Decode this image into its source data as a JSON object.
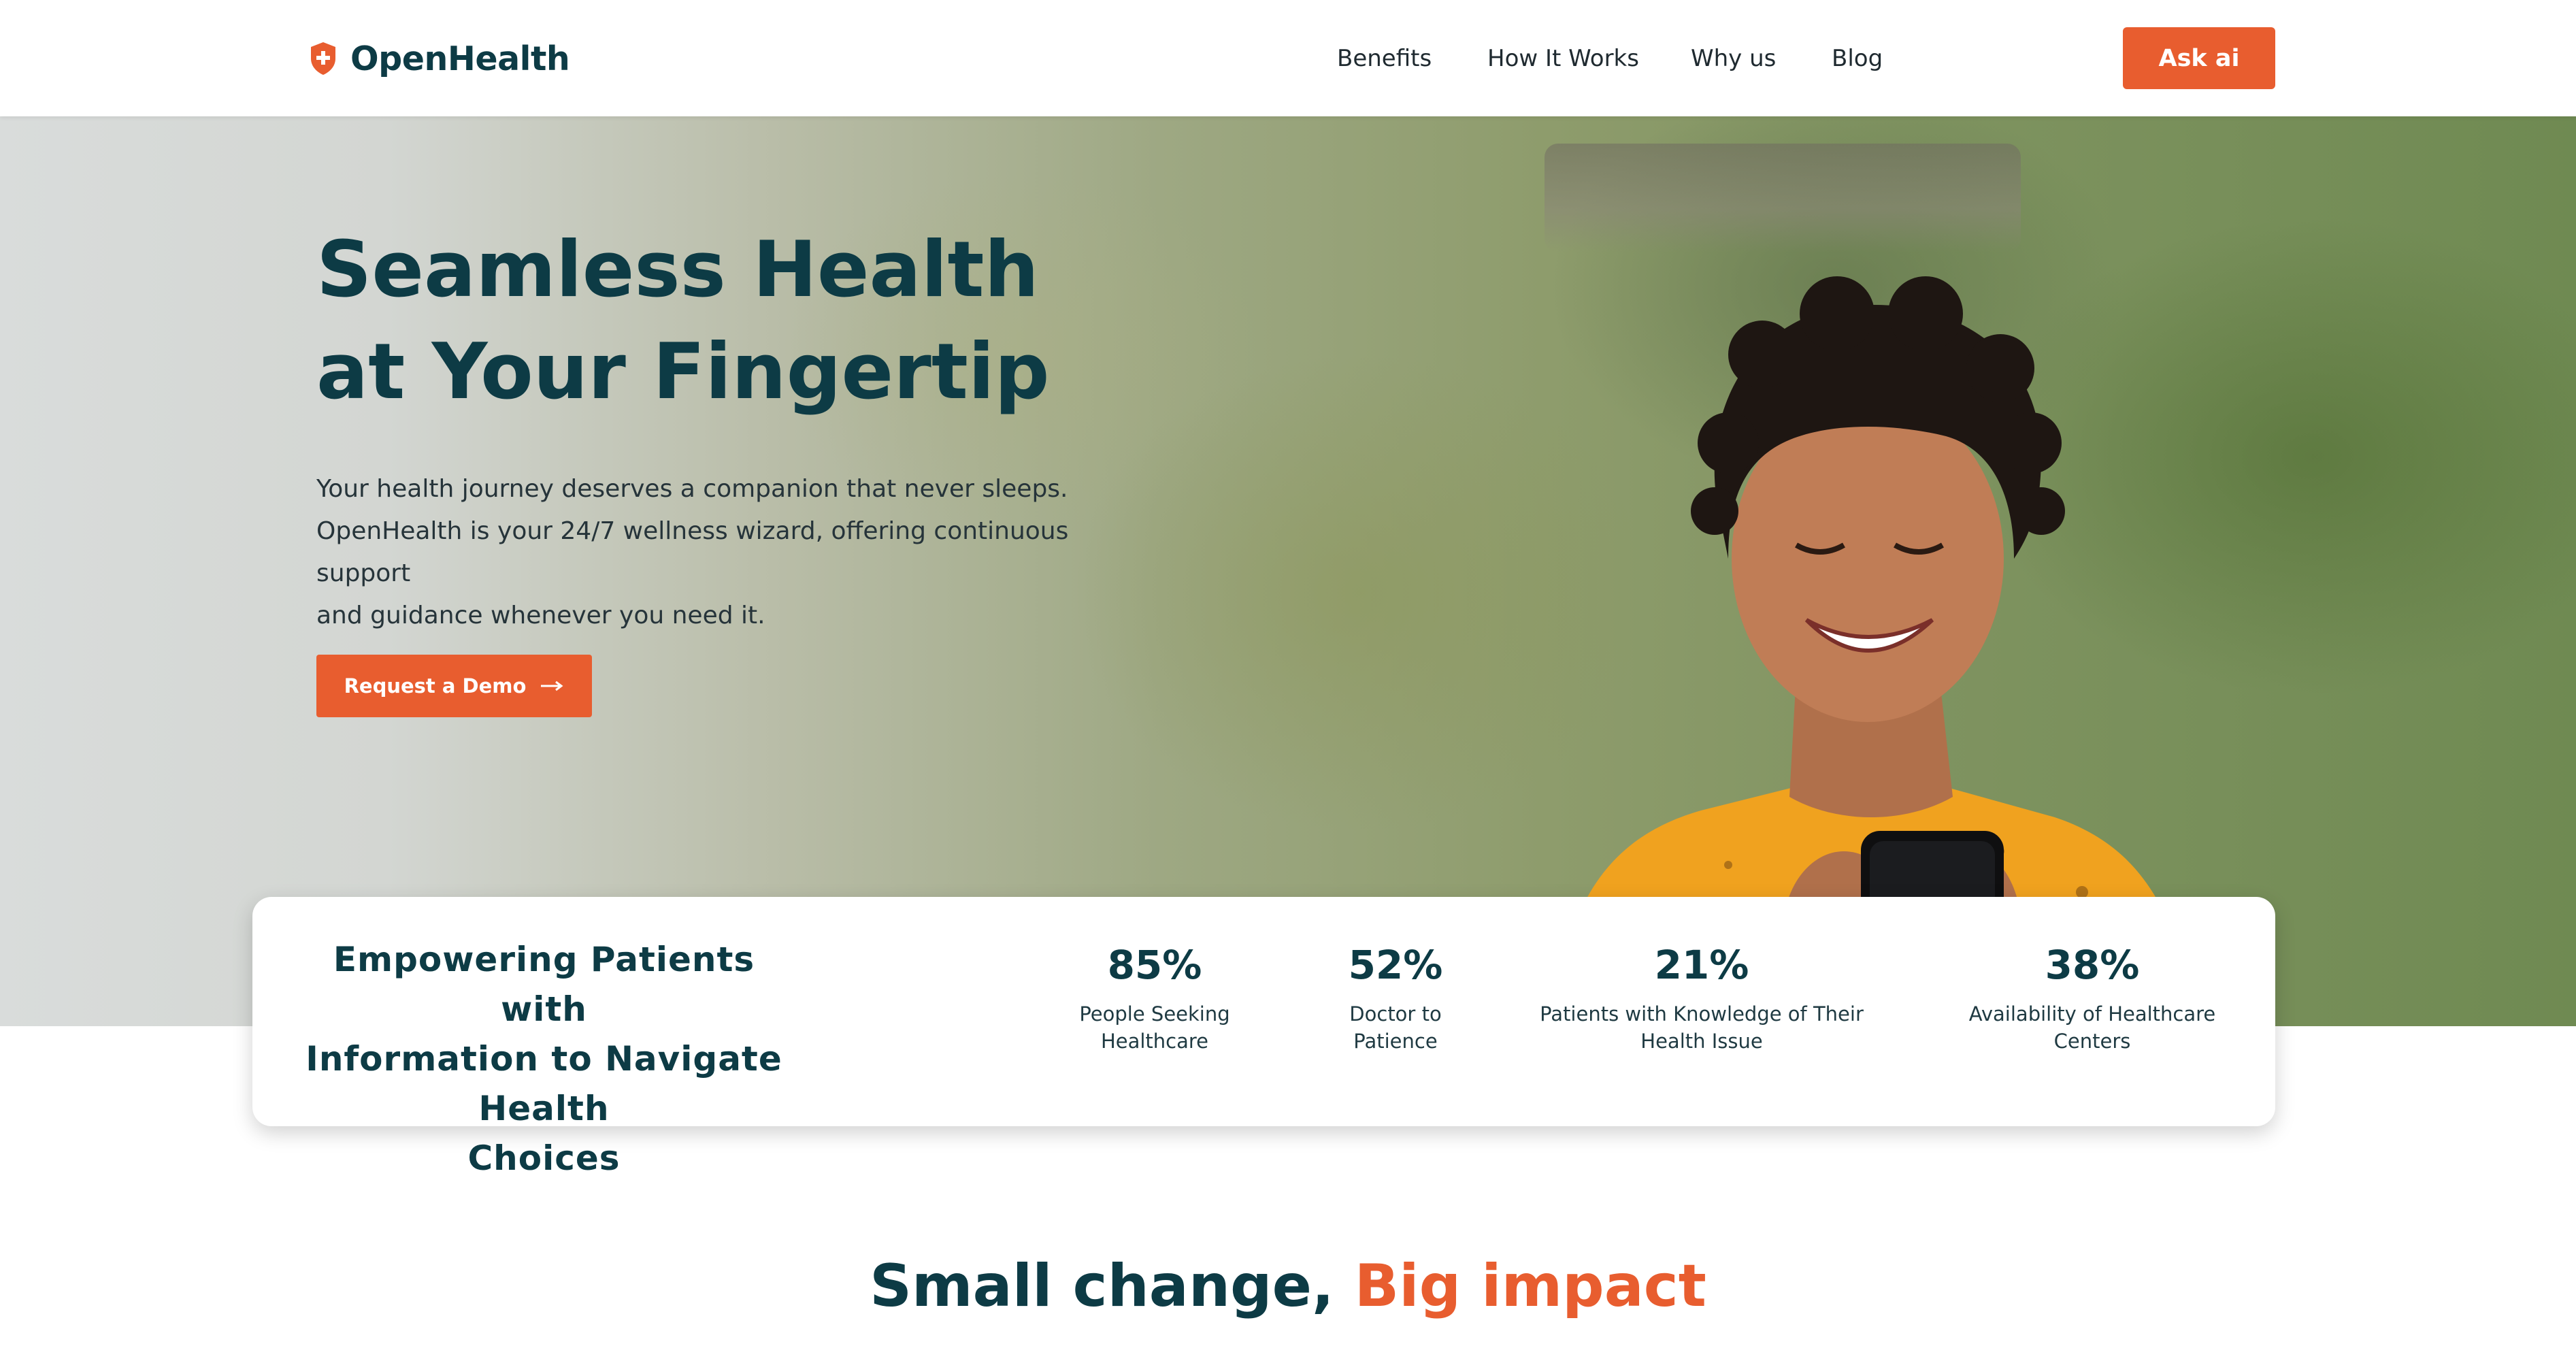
{
  "brand": {
    "name": "OpenHealth",
    "accent_color": "#e85d2f",
    "primary_color": "#0d3b45"
  },
  "nav": {
    "items": [
      "Benefits",
      "How It Works",
      "Why us",
      "Blog"
    ],
    "cta_label": "Ask ai"
  },
  "hero": {
    "title_line1": "Seamless Health",
    "title_line2": "at Your Fingertip",
    "subtitle_line1": "Your health journey deserves a companion that never sleeps.",
    "subtitle_line2": "OpenHealth is your 24/7 wellness wizard, offering continuous support",
    "subtitle_line3": "and guidance whenever you need it.",
    "cta_label": "Request a Demo",
    "cta_icon": "arrow-right-icon",
    "image": "woman-smiling-with-phone"
  },
  "stats": {
    "heading_line1": "Empowering Patients with",
    "heading_line2": "Information to Navigate Health",
    "heading_line3": "Choices",
    "items": [
      {
        "value": "85%",
        "label_line1": "People Seeking",
        "label_line2": "Healthcare"
      },
      {
        "value": "52%",
        "label_line1": "Doctor to",
        "label_line2": "Patience"
      },
      {
        "value": "21%",
        "label_line1": "Patients with Knowledge of Their",
        "label_line2": "Health Issue"
      },
      {
        "value": "38%",
        "label_line1": "Availability of Healthcare",
        "label_line2": "Centers"
      }
    ]
  },
  "section": {
    "title_main": "Small change, ",
    "title_accent": "Big impact"
  }
}
